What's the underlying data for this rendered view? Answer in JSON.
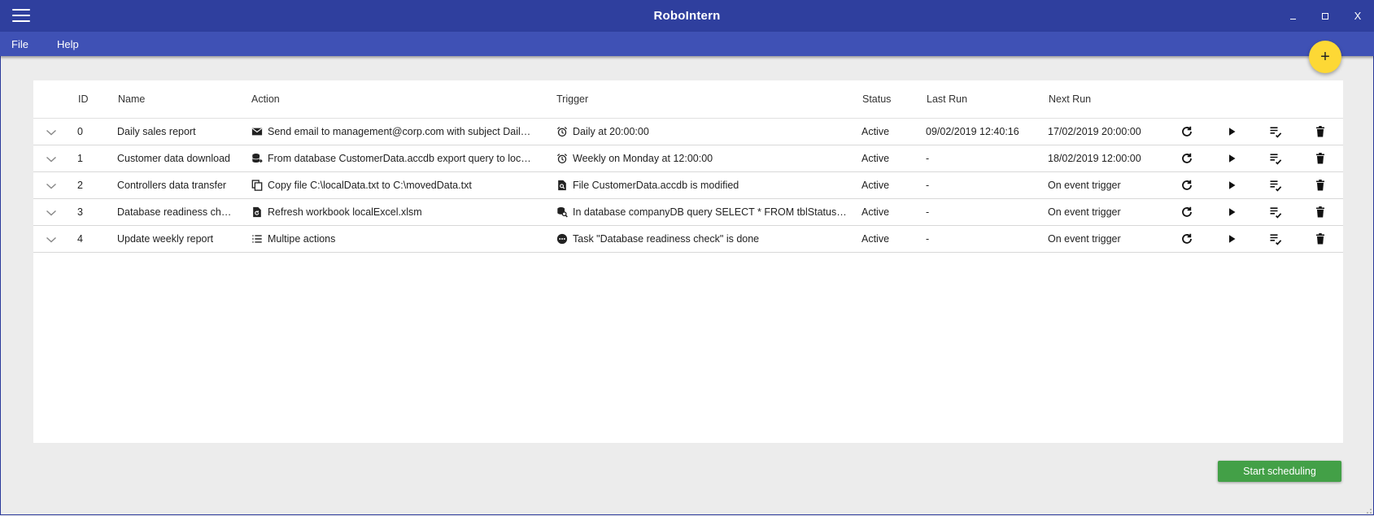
{
  "app": {
    "title": "RoboIntern"
  },
  "window_controls": {
    "close": "X"
  },
  "menu": {
    "file": "File",
    "help": "Help"
  },
  "fab": {
    "label": "+"
  },
  "grid": {
    "columns": {
      "id": "ID",
      "name": "Name",
      "action": "Action",
      "trigger": "Trigger",
      "status": "Status",
      "last_run": "Last Run",
      "next_run": "Next Run"
    },
    "rows": [
      {
        "id": "0",
        "name": "Daily sales report",
        "action_icon": "email-icon",
        "action": "Send email to management@corp.com with subject Dail…",
        "trigger_icon": "alarm-icon",
        "trigger": "Daily at 20:00:00",
        "status": "Active",
        "last_run": "09/02/2019 12:40:16",
        "next_run": "17/02/2019 20:00:00"
      },
      {
        "id": "1",
        "name": "Customer data download",
        "action_icon": "database-export-icon",
        "action": "From database CustomerData.accdb export query to loca…",
        "trigger_icon": "alarm-icon",
        "trigger": "Weekly on Monday at 12:00:00",
        "status": "Active",
        "last_run": "-",
        "next_run": "18/02/2019 12:00:00"
      },
      {
        "id": "2",
        "name": "Controllers data transfer",
        "action_icon": "copy-icon",
        "action": "Copy file C:\\localData.txt to C:\\movedData.txt",
        "trigger_icon": "file-search-icon",
        "trigger": "File CustomerData.accdb is modified",
        "status": "Active",
        "last_run": "-",
        "next_run": "On event trigger"
      },
      {
        "id": "3",
        "name": "Database readiness ch…",
        "action_icon": "file-refresh-icon",
        "action": "Refresh workbook localExcel.xlsm",
        "trigger_icon": "database-search-icon",
        "trigger": "In database companyDB query SELECT * FROM tblStatus…",
        "status": "Active",
        "last_run": "-",
        "next_run": "On event trigger"
      },
      {
        "id": "4",
        "name": "Update weekly report",
        "action_icon": "list-icon",
        "action": "Multipe actions",
        "trigger_icon": "dots-circle-icon",
        "trigger": "Task \"Database readiness check\" is done",
        "status": "Active",
        "last_run": "-",
        "next_run": "On event trigger"
      }
    ]
  },
  "footer": {
    "start_label": "Start scheduling"
  },
  "colors": {
    "titlebar": "#2f3f9e",
    "menubar": "#3f51b5",
    "fab": "#fdd835",
    "start_button": "#43a047",
    "background": "#ececec"
  }
}
